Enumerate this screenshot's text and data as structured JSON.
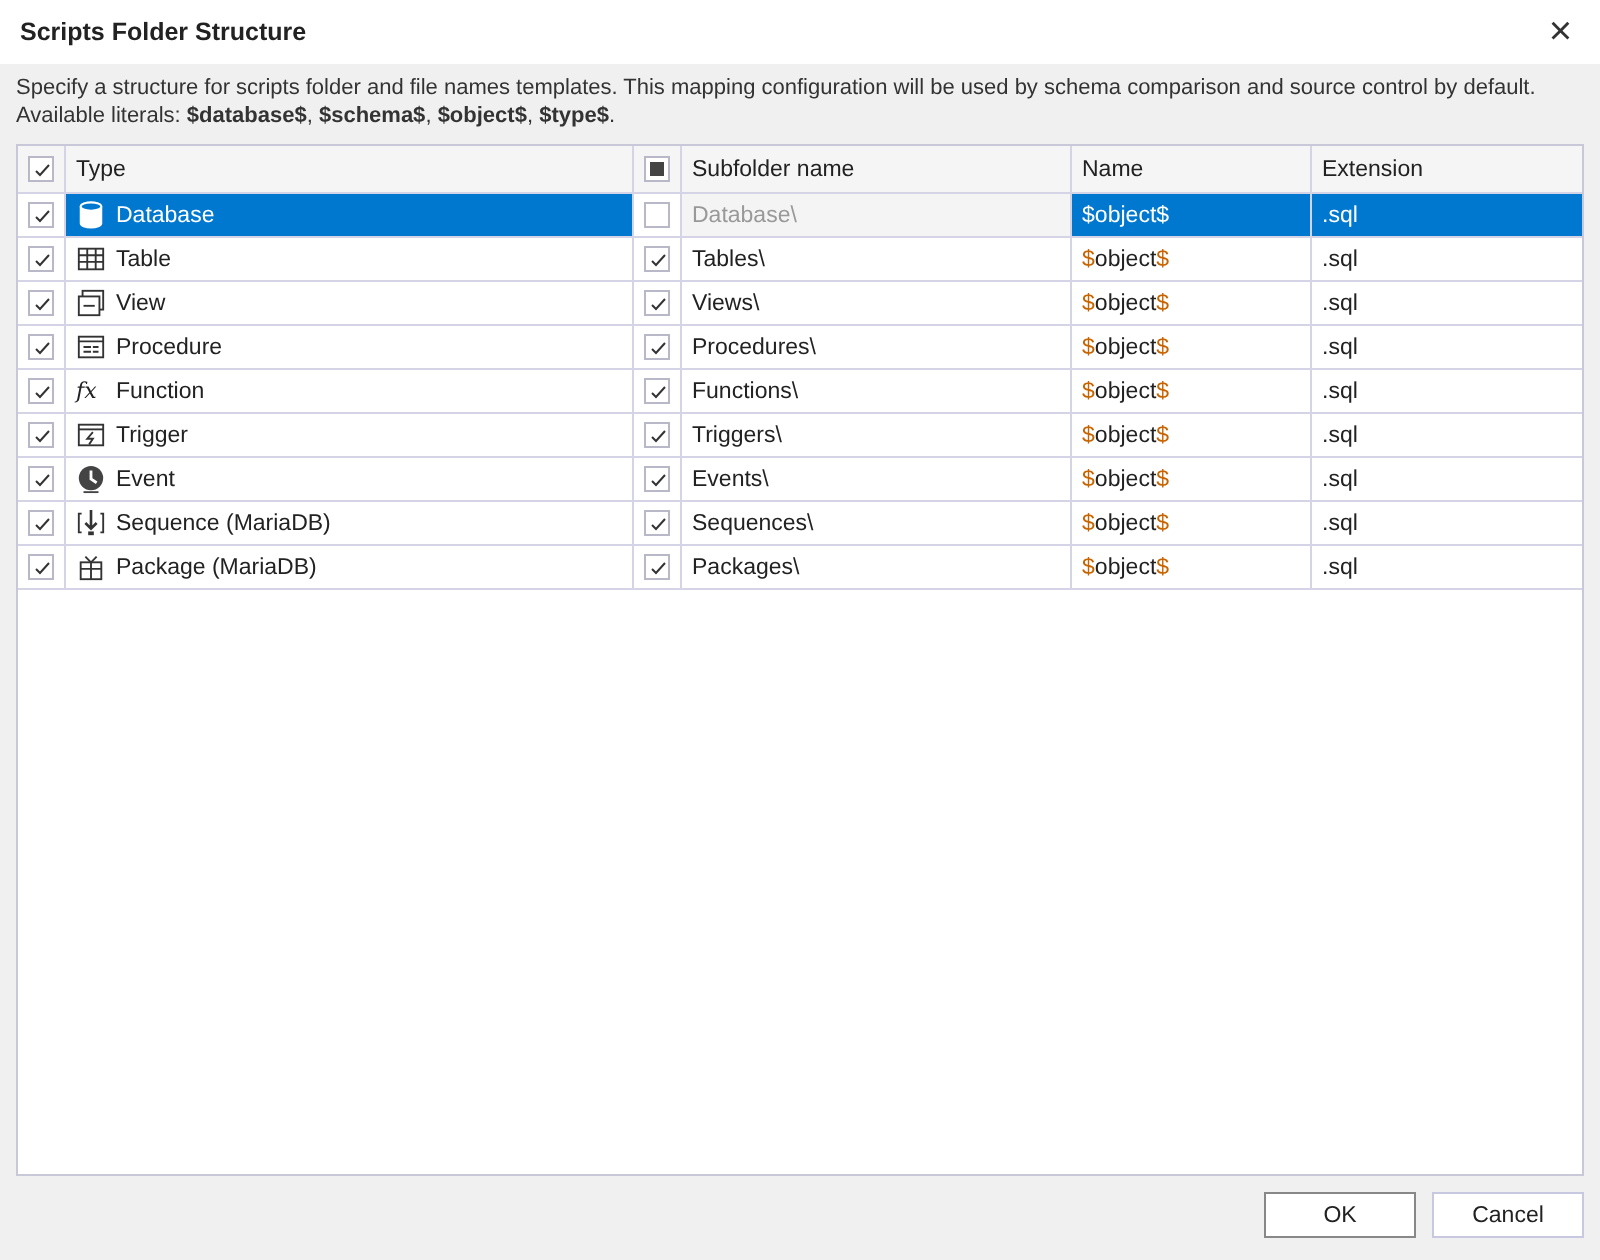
{
  "window": {
    "title": "Scripts Folder Structure",
    "close": "×"
  },
  "description": "Specify a structure for scripts folder and file names templates. This mapping configuration will be used by schema comparison and source control by default.\nAvailable literals: **$database$**, **$schema$**, **$object$**, **$type$**.",
  "table": {
    "header": {
      "include_checked": true,
      "type": "Type",
      "subfolder_mixed": true,
      "subfolder": "Subfolder name",
      "name": "Name",
      "extension": "Extension"
    },
    "rows": [
      {
        "include": true,
        "kind": "database",
        "type": "Database",
        "subfolder_on": false,
        "subfolder": "Database\\",
        "name": "$object$",
        "extension": ".sql",
        "selected": true
      },
      {
        "include": true,
        "kind": "table",
        "type": "Table",
        "subfolder_on": true,
        "subfolder": "Tables\\",
        "name": "$object$",
        "extension": ".sql",
        "selected": false
      },
      {
        "include": true,
        "kind": "view",
        "type": "View",
        "subfolder_on": true,
        "subfolder": "Views\\",
        "name": "$object$",
        "extension": ".sql",
        "selected": false
      },
      {
        "include": true,
        "kind": "procedure",
        "type": "Procedure",
        "subfolder_on": true,
        "subfolder": "Procedures\\",
        "name": "$object$",
        "extension": ".sql",
        "selected": false
      },
      {
        "include": true,
        "kind": "function",
        "symbol": "fx",
        "type": "Function",
        "subfolder_on": true,
        "subfolder": "Functions\\",
        "name": "$object$",
        "extension": ".sql",
        "selected": false
      },
      {
        "include": true,
        "kind": "trigger",
        "type": "Trigger",
        "subfolder_on": true,
        "subfolder": "Triggers\\",
        "name": "$object$",
        "extension": ".sql",
        "selected": false
      },
      {
        "include": true,
        "kind": "event",
        "type": "Event",
        "subfolder_on": true,
        "subfolder": "Events\\",
        "name": "$object$",
        "extension": ".sql",
        "selected": false
      },
      {
        "include": true,
        "kind": "sequence",
        "type": "Sequence (MariaDB)",
        "subfolder_on": true,
        "subfolder": "Sequences\\",
        "name": "$object$",
        "extension": ".sql",
        "selected": false
      },
      {
        "include": true,
        "kind": "package",
        "type": "Package (MariaDB)",
        "subfolder_on": true,
        "subfolder": "Packages\\",
        "name": "$object$",
        "extension": ".sql",
        "selected": false
      }
    ]
  },
  "buttons": [
    {
      "label": "OK",
      "default": true
    },
    {
      "label": "Cancel",
      "default": false
    }
  ]
}
